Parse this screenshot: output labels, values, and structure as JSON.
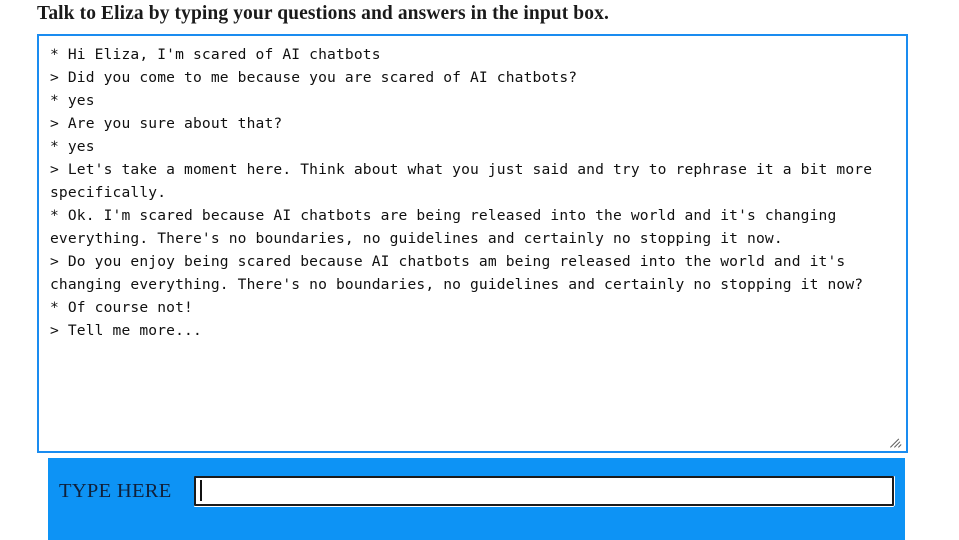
{
  "page": {
    "title": "Talk to Eliza by typing your questions and answers in the input box."
  },
  "transcript": {
    "text": "* Hi Eliza, I'm scared of AI chatbots\n> Did you come to me because you are scared of AI chatbots?\n* yes\n> Are you sure about that?\n* yes\n> Let's take a moment here. Think about what you just said and try to rephrase it a bit more specifically.\n* Ok. I'm scared because AI chatbots are being released into the world and it's changing everything. There's no boundaries, no guidelines and certainly no stopping it now.\n> Do you enjoy being scared because AI chatbots am being released into the world and it's changing everything. There's no boundaries, no guidelines and certainly no stopping it now?\n* Of course not!\n> Tell me more...",
    "lines": [
      "* Hi Eliza, I'm scared of AI chatbots",
      "> Did you come to me because you are scared of AI chatbots?",
      "* yes",
      "> Are you sure about that?",
      "* yes",
      "> Let's take a moment here. Think about what you just said and try to rephrase it a bit more specifically.",
      "* Ok. I'm scared because AI chatbots are being released into the world and it's changing everything. There's no boundaries, no guidelines and certainly no stopping it now.",
      "> Do you enjoy being scared because AI chatbots am being released into the world and it's changing everything. There's no boundaries, no guidelines and certainly no stopping it now?",
      "* Of course not!",
      "> Tell me more..."
    ],
    "resize_grip": "resize-grip-icon"
  },
  "input_bar": {
    "label": "TYPE HERE",
    "value": "",
    "placeholder": ""
  },
  "colors": {
    "accent_blue": "#0d93f5",
    "border_blue": "#1a8cf0",
    "text": "#101010",
    "label_text": "#10203a",
    "input_border": "#1b1b1b",
    "background": "#ffffff"
  }
}
